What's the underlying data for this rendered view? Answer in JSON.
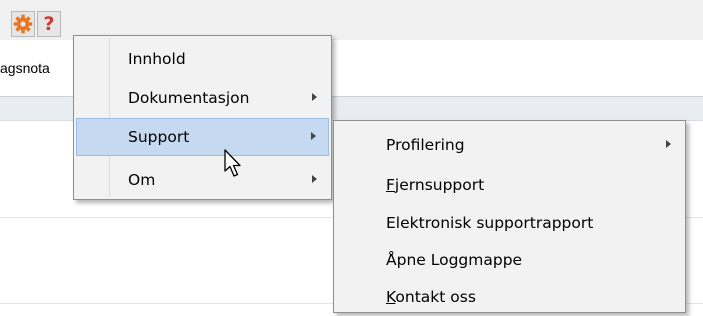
{
  "toolbar": {
    "gear_icon": "gear-icon",
    "help_icon": "help-icon",
    "help_glyph": "?",
    "gear_color": "#e87722",
    "help_color": "#d3372b"
  },
  "tab_label": "agsnota",
  "main_menu": {
    "items": [
      {
        "label": "Innhold",
        "has_submenu": false
      },
      {
        "label": "Dokumentasjon",
        "has_submenu": true
      },
      {
        "label": "Support",
        "has_submenu": true,
        "highlighted": true
      },
      {
        "label": "Om",
        "has_submenu": true
      }
    ]
  },
  "submenu": {
    "items": [
      {
        "label": "Profilering",
        "has_submenu": true
      },
      {
        "label_underline": "F",
        "label_rest": "jernsupport",
        "label": "Fjernsupport"
      },
      {
        "label": "Elektronisk supportrapport"
      },
      {
        "label": "Åpne Loggmappe"
      },
      {
        "label_underline": "K",
        "label_rest": "ontakt oss",
        "label": "Kontakt oss"
      }
    ]
  },
  "highlight_color": "#c5d9f1",
  "cursor_icon": "mouse-pointer-icon"
}
